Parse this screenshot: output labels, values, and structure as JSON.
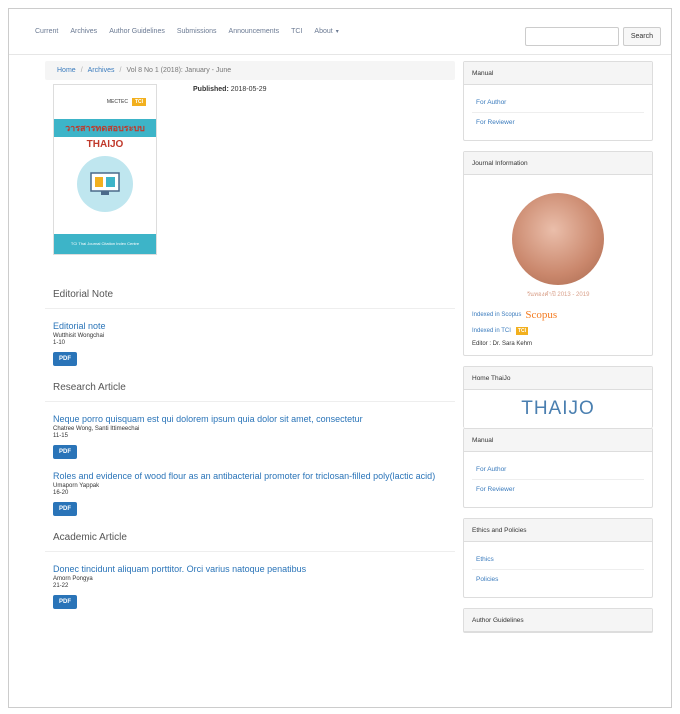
{
  "nav": {
    "items": [
      "Current",
      "Archives",
      "Author Guidelines",
      "Submissions",
      "Announcements",
      "TCI"
    ],
    "about": "About",
    "search_placeholder": "",
    "search_button": "Search"
  },
  "breadcrumb": {
    "home": "Home",
    "archives": "Archives",
    "current": "Vol 8 No 1 (2018): January - June"
  },
  "cover": {
    "mectec": "MECTEC",
    "tci": "TCI",
    "thai_title": "วารสารทดสอบระบบ",
    "thaijo": "THAIJO",
    "bottom": "TCI Thai Journal Citation Index Centre"
  },
  "published": {
    "label": "Published:",
    "date": "2018-05-29"
  },
  "sections": [
    {
      "title": "Editorial Note",
      "articles": [
        {
          "title": "Editorial note",
          "authors": "Wutthisit Wongchai",
          "pages": "1-10",
          "pdf": "PDF"
        }
      ]
    },
    {
      "title": "Research Article",
      "articles": [
        {
          "title": "Neque porro quisquam est qui dolorem ipsum quia dolor sit amet, consectetur",
          "authors": "Chatree Wong, Santi Ittimeechai",
          "pages": "11-15",
          "pdf": "PDF"
        },
        {
          "title": "Roles and evidence of wood flour as an antibacterial promoter for triclosan-filled poly(lactic acid)",
          "authors": "Umaporn Yappak",
          "pages": "16-20",
          "pdf": "PDF"
        }
      ]
    },
    {
      "title": "Academic Article",
      "articles": [
        {
          "title": "Donec tincidunt aliquam porttitor. Orci varius natoque penatibus",
          "authors": "Amorn Pongya",
          "pages": "21-22",
          "pdf": "PDF"
        }
      ]
    }
  ],
  "sidebar": {
    "manual1": {
      "title": "Manual",
      "links": [
        "For Author",
        "For Reviewer"
      ]
    },
    "journal_info": {
      "title": "Journal Information",
      "medal_caption": "วันทองคำปี 2013 - 2019",
      "indexed_scopus": "Indexed in Scopus",
      "scopus": "Scopus",
      "indexed_tci": "Indexed in TCI",
      "tci": "TCI",
      "editor": "Editor : Dr. Sara Kehm"
    },
    "home_thaijo": {
      "title": "Home ThaiJo",
      "logo": "THAIJO"
    },
    "manual2": {
      "title": "Manual",
      "links": [
        "For Author",
        "For Reviewer"
      ]
    },
    "ethics": {
      "title": "Ethics and Policies",
      "links": [
        "Ethics",
        "Policies"
      ]
    },
    "author_guidelines": {
      "title": "Author Guidelines"
    }
  }
}
